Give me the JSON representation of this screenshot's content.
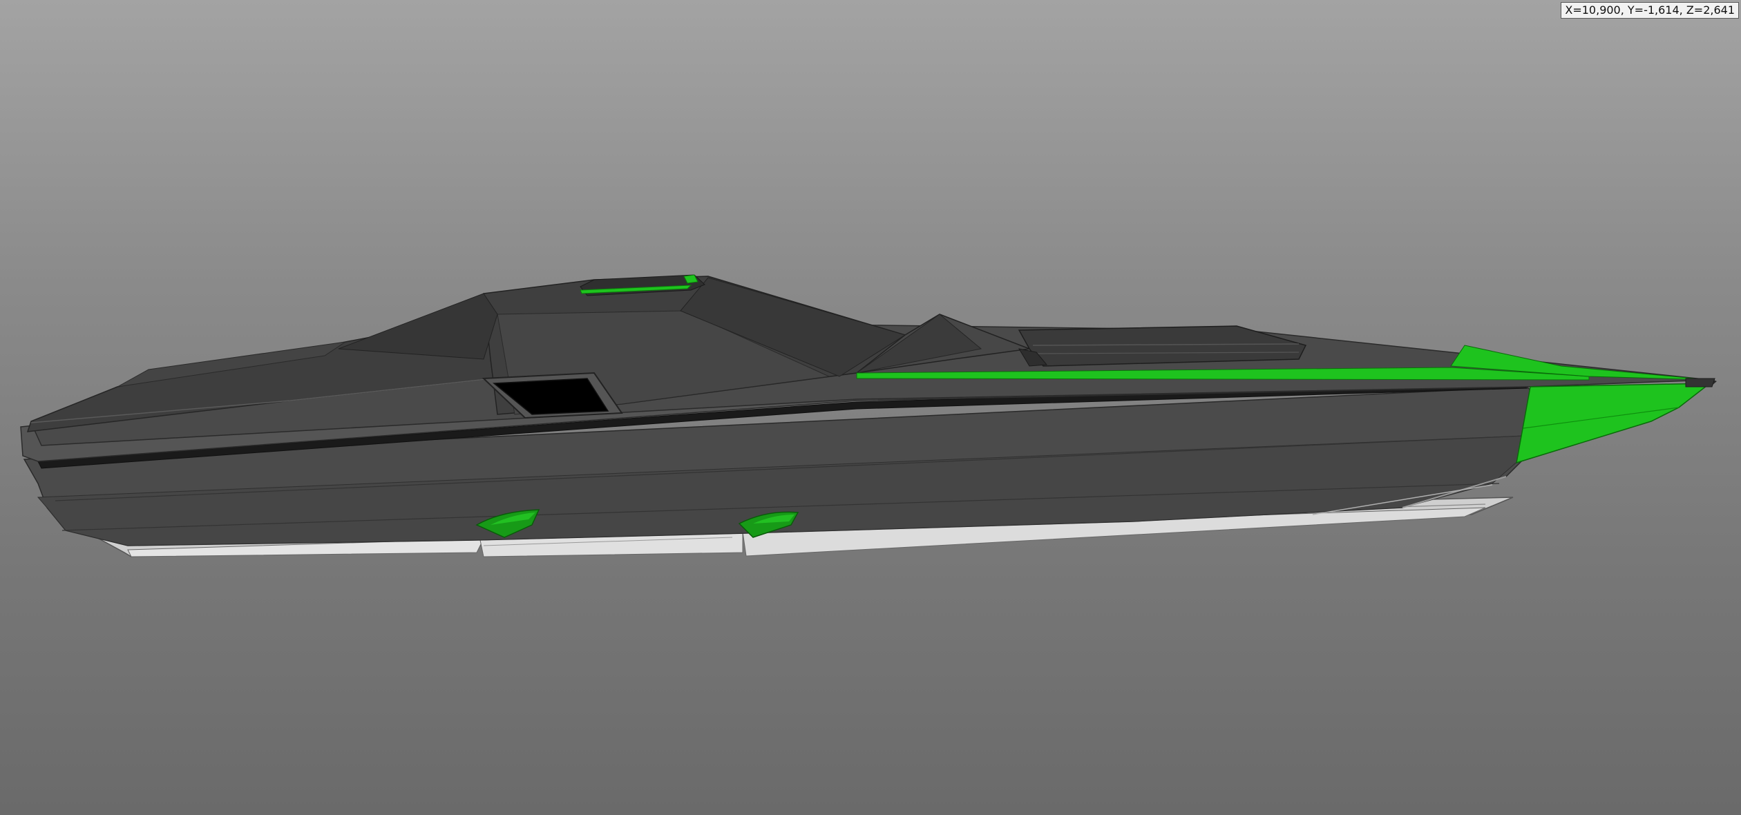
{
  "viewport": {
    "coordinate_readout": "X=10,900, Y=-1,614, Z=2,641"
  },
  "model": {
    "colors": {
      "hull": "#4a4a4a",
      "hull_dark": "#3b3b3b",
      "deck": "#444444",
      "accent_green": "#1ec31e",
      "keel_light": "#d8d8d8",
      "window": "#000000"
    }
  }
}
